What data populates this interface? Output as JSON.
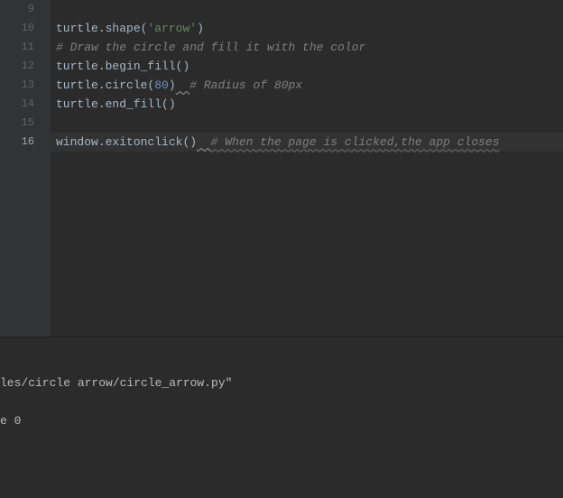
{
  "editor": {
    "lines": [
      {
        "num": "9",
        "tokens": []
      },
      {
        "num": "10",
        "tokens": [
          {
            "cls": "obj",
            "t": "turtle"
          },
          {
            "cls": "dot",
            "t": "."
          },
          {
            "cls": "method",
            "t": "shape"
          },
          {
            "cls": "paren",
            "t": "("
          },
          {
            "cls": "string",
            "t": "'arrow'"
          },
          {
            "cls": "paren",
            "t": ")"
          }
        ]
      },
      {
        "num": "11",
        "tokens": [
          {
            "cls": "comment",
            "t": "# Draw the circle and fill it with the color"
          }
        ]
      },
      {
        "num": "12",
        "tokens": [
          {
            "cls": "obj",
            "t": "turtle"
          },
          {
            "cls": "dot",
            "t": "."
          },
          {
            "cls": "method",
            "t": "begin_fill"
          },
          {
            "cls": "paren",
            "t": "()"
          }
        ]
      },
      {
        "num": "13",
        "tokens": [
          {
            "cls": "obj",
            "t": "turtle"
          },
          {
            "cls": "dot",
            "t": "."
          },
          {
            "cls": "method",
            "t": "circle"
          },
          {
            "cls": "paren",
            "t": "("
          },
          {
            "cls": "number",
            "t": "80"
          },
          {
            "cls": "paren",
            "t": ")"
          },
          {
            "cls": "squiggle",
            "t": "  "
          },
          {
            "cls": "comment",
            "t": "# Radius of 80px"
          }
        ]
      },
      {
        "num": "14",
        "tokens": [
          {
            "cls": "obj",
            "t": "turtle"
          },
          {
            "cls": "dot",
            "t": "."
          },
          {
            "cls": "method",
            "t": "end_fill"
          },
          {
            "cls": "paren",
            "t": "()"
          }
        ]
      },
      {
        "num": "15",
        "tokens": []
      },
      {
        "num": "16",
        "highlighted": true,
        "tokens": [
          {
            "cls": "obj",
            "t": "window"
          },
          {
            "cls": "dot",
            "t": "."
          },
          {
            "cls": "method",
            "t": "exitonclick"
          },
          {
            "cls": "paren",
            "t": "()"
          },
          {
            "cls": "squiggle",
            "t": "  "
          },
          {
            "cls": "comment-underline",
            "t": "# When the page is clicked,the app closes"
          }
        ]
      }
    ]
  },
  "terminal": {
    "line1": "les/circle arrow/circle_arrow.py\"",
    "line2": "e 0"
  }
}
